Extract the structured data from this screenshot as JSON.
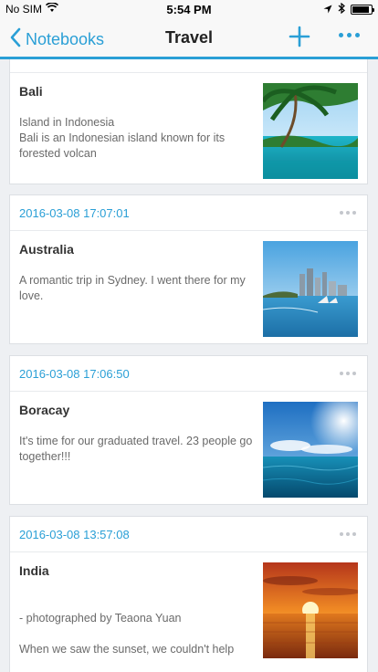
{
  "status_bar": {
    "carrier": "No SIM",
    "time": "5:54 PM",
    "battery_level": 0.9
  },
  "nav": {
    "back_label": "Notebooks",
    "title": "Travel"
  },
  "notes": [
    {
      "date": "",
      "title": "Bali",
      "text": "Island in Indonesia\nBali is an Indonesian island known for its forested volcan",
      "image": "tropical-beach-palms"
    },
    {
      "date": "2016-03-08 17:07:01",
      "title": "Australia",
      "text": "A romantic trip in Sydney. I went there for my love.",
      "image": "sydney-harbour-skyline"
    },
    {
      "date": "2016-03-08 17:06:50",
      "title": "Boracay",
      "text": "It's time for our graduated travel. 23 people go together!!!",
      "image": "ocean-blue-sky"
    },
    {
      "date": "2016-03-08 13:57:08",
      "title": "India",
      "text": "- photographed by Teaona Yuan\n\nWhen we saw the sunset, we couldn't help",
      "image": "sunset-over-sea"
    }
  ]
}
